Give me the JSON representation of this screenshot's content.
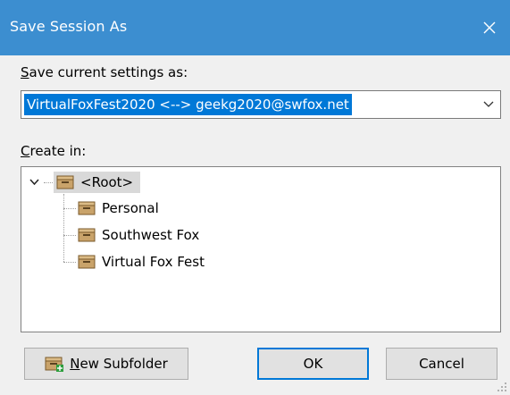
{
  "window": {
    "title": "Save Session As",
    "close_icon": "close-icon",
    "titlebar_color": "#3c8ed0"
  },
  "save_as": {
    "label_mnemonic": "S",
    "label_rest": "ave current settings as:",
    "value": "VirtualFoxFest2020 <--> geekg2020@swfox.net",
    "dropdown_icon": "chevron-down-icon",
    "selection_color": "#0078d7"
  },
  "create_in": {
    "label_mnemonic": "C",
    "label_rest": "reate in:",
    "tree": {
      "root": {
        "label": "<Root>",
        "expanded": true,
        "selected": true
      },
      "children": [
        {
          "label": "Personal"
        },
        {
          "label": "Southwest Fox"
        },
        {
          "label": "Virtual Fox Fest"
        }
      ],
      "folder_icon": "folder-icon"
    }
  },
  "buttons": {
    "new_subfolder_mnemonic": "N",
    "new_subfolder_rest": "ew Subfolder",
    "new_subfolder_icon": "new-folder-icon",
    "ok": "OK",
    "cancel": "Cancel"
  }
}
